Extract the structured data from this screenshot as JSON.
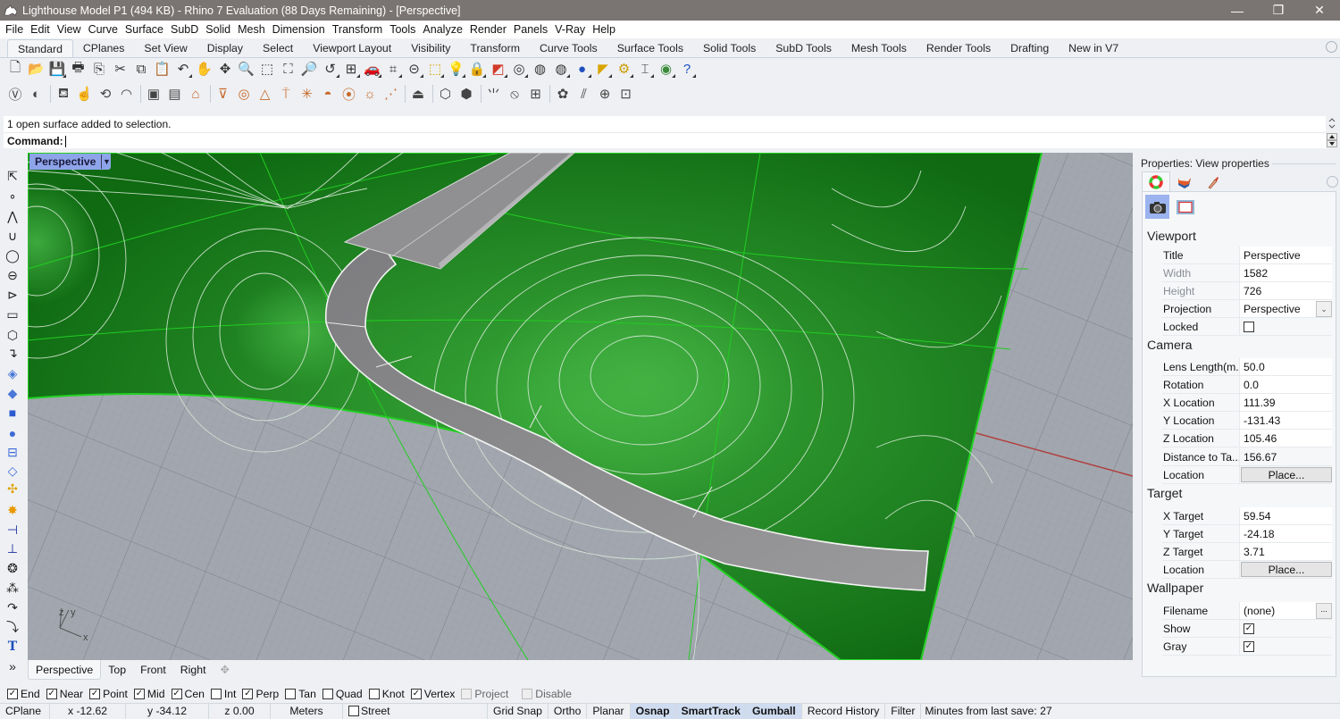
{
  "window": {
    "title": "Lighthouse Model P1 (494 KB) - Rhino 7 Evaluation (88 Days Remaining) - [Perspective]",
    "controls": {
      "minimize": "—",
      "restore": "❐",
      "close": "✕"
    }
  },
  "menu": [
    "File",
    "Edit",
    "View",
    "Curve",
    "Surface",
    "SubD",
    "Solid",
    "Mesh",
    "Dimension",
    "Transform",
    "Tools",
    "Analyze",
    "Render",
    "Panels",
    "V-Ray",
    "Help"
  ],
  "toolbar_tabs": {
    "active": "Standard",
    "items": [
      "Standard",
      "CPlanes",
      "Set View",
      "Display",
      "Select",
      "Viewport Layout",
      "Visibility",
      "Transform",
      "Curve Tools",
      "Surface Tools",
      "Solid Tools",
      "SubD Tools",
      "Mesh Tools",
      "Render Tools",
      "Drafting",
      "New in V7"
    ]
  },
  "standard_toolbar": [
    {
      "name": "new-file-icon",
      "glyph": "🗋"
    },
    {
      "name": "open-file-icon",
      "glyph": "📂"
    },
    {
      "name": "save-icon",
      "glyph": "💾",
      "sub": true
    },
    {
      "name": "print-icon",
      "glyph": "🖶"
    },
    {
      "name": "import-icon",
      "glyph": "⎘"
    },
    {
      "name": "cut-icon",
      "glyph": "✂"
    },
    {
      "name": "copy-icon",
      "glyph": "⧉"
    },
    {
      "name": "paste-icon",
      "glyph": "📋"
    },
    {
      "name": "undo-icon",
      "glyph": "↶",
      "sub": true
    },
    {
      "name": "pan-icon",
      "glyph": "✋"
    },
    {
      "name": "rotate-view-icon",
      "glyph": "✥"
    },
    {
      "name": "zoom-icon",
      "glyph": "🔍"
    },
    {
      "name": "zoom-window-icon",
      "glyph": "⬚"
    },
    {
      "name": "zoom-extents-icon",
      "glyph": "⛶"
    },
    {
      "name": "zoom-selected-icon",
      "glyph": "🔎"
    },
    {
      "name": "undo-view-icon",
      "glyph": "↺",
      "sub": true
    },
    {
      "name": "four-viewports-icon",
      "glyph": "⊞",
      "sub": true
    },
    {
      "name": "car-icon",
      "glyph": "🚗",
      "sub": true
    },
    {
      "name": "cplane-icon",
      "glyph": "⌗",
      "sub": true
    },
    {
      "name": "distance-icon",
      "glyph": "⊝",
      "sub": true
    },
    {
      "name": "grip-icon",
      "glyph": "⬚",
      "sub": true
    },
    {
      "name": "light-bulb-icon",
      "glyph": "💡",
      "sub": true
    },
    {
      "name": "lock-icon",
      "glyph": "🔒",
      "sub": true
    },
    {
      "name": "layers-icon",
      "glyph": "◩",
      "sub": true
    },
    {
      "name": "color-wheel-icon",
      "glyph": "◎",
      "sub": true
    },
    {
      "name": "wireframe-sphere-icon",
      "glyph": "◍"
    },
    {
      "name": "shaded-sphere-icon",
      "glyph": "◍",
      "sub": true
    },
    {
      "name": "render-sphere-icon",
      "glyph": "●",
      "sub": true
    },
    {
      "name": "sun-icon",
      "glyph": "◤",
      "sub": true
    },
    {
      "name": "options-icon",
      "glyph": "⚙",
      "sub": true
    },
    {
      "name": "dimension-icon",
      "glyph": "⌶",
      "sub": true
    },
    {
      "name": "grasshopper-icon",
      "glyph": "◉",
      "sub": true
    },
    {
      "name": "help-icon",
      "glyph": "?",
      "sub": true
    }
  ],
  "vray_toolbar": [
    {
      "name": "vray-logo-icon",
      "glyph": "Ⓥ"
    },
    {
      "name": "vray-asset-editor-icon",
      "glyph": "◐"
    },
    {
      "name": "sep"
    },
    {
      "name": "render-icon",
      "glyph": "⛾"
    },
    {
      "name": "interactive-render-icon",
      "glyph": "☝"
    },
    {
      "name": "render-cloud-icon",
      "glyph": "⟲"
    },
    {
      "name": "vision-icon",
      "glyph": "◠"
    },
    {
      "name": "sep"
    },
    {
      "name": "frame-buffer-icon",
      "glyph": "▣"
    },
    {
      "name": "frame-buffer-history-icon",
      "glyph": "▤"
    },
    {
      "name": "lightmix-icon",
      "glyph": "⌂"
    },
    {
      "name": "sep"
    },
    {
      "name": "rect-light-icon",
      "glyph": "⊽"
    },
    {
      "name": "sphere-light-icon",
      "glyph": "◎"
    },
    {
      "name": "spot-light-icon",
      "glyph": "△"
    },
    {
      "name": "ies-light-icon",
      "glyph": "⍑"
    },
    {
      "name": "omni-light-icon",
      "glyph": "✳"
    },
    {
      "name": "dome-light-icon",
      "glyph": "◓"
    },
    {
      "name": "mesh-light-icon",
      "glyph": "⦿"
    },
    {
      "name": "sun-light-icon",
      "glyph": "☼"
    },
    {
      "name": "direct-light-icon",
      "glyph": "⋰"
    },
    {
      "name": "sep"
    },
    {
      "name": "camera-icon",
      "glyph": "⏏"
    },
    {
      "name": "sep"
    },
    {
      "name": "proxy-export-icon",
      "glyph": "⬡"
    },
    {
      "name": "proxy-import-icon",
      "glyph": "⬢"
    },
    {
      "name": "sep"
    },
    {
      "name": "fur-icon",
      "glyph": "⺌"
    },
    {
      "name": "clipper-icon",
      "glyph": "⦸"
    },
    {
      "name": "mesh-clipper-icon",
      "glyph": "⊞"
    },
    {
      "name": "sep"
    },
    {
      "name": "material-pick-icon",
      "glyph": "✿"
    },
    {
      "name": "infinite-plane-icon",
      "glyph": "⫽"
    },
    {
      "name": "bake-icon",
      "glyph": "⊕"
    },
    {
      "name": "lock-camera-icon",
      "glyph": "⊡"
    }
  ],
  "command": {
    "history": "1 open surface added to selection.",
    "prompt_label": "Command:",
    "value": ""
  },
  "left_toolbar": [
    "select-icon",
    "point-icon",
    "polyline-icon",
    "curve-icon",
    "circle-icon",
    "ellipse-icon",
    "arc-icon",
    "rectangle-icon",
    "polygon-icon",
    "fillet-curve-icon",
    "surface-from-points-icon",
    "extrude-surface-icon",
    "box-icon",
    "sphere-boolean-icon",
    "cylinder-icon",
    "mesh-icon",
    "puzzle-icon",
    "explode-icon",
    "split-icon",
    "trim-icon",
    "group-icon",
    "points-on-icon",
    "curve-tools-icon",
    "fillet-edge-icon",
    "text-icon",
    "more-icon"
  ],
  "viewport": {
    "label": "Perspective",
    "axes": {
      "x": "x",
      "y": "y",
      "z": "z"
    },
    "colors": {
      "terrain": "#1d7e1d",
      "terrain_light": "#3aa93a",
      "road": "#8c8c8c",
      "grid": "#a2a7af",
      "x_axis": "#b0413e",
      "edge_highlight": "#22d022"
    }
  },
  "viewport_tabs": {
    "active": "Perspective",
    "items": [
      "Perspective",
      "Top",
      "Front",
      "Right"
    ],
    "add_icon": "✥"
  },
  "osnaps": [
    {
      "label": "End",
      "checked": true
    },
    {
      "label": "Near",
      "checked": true
    },
    {
      "label": "Point",
      "checked": true
    },
    {
      "label": "Mid",
      "checked": true
    },
    {
      "label": "Cen",
      "checked": true
    },
    {
      "label": "Int",
      "checked": false
    },
    {
      "label": "Perp",
      "checked": true
    },
    {
      "label": "Tan",
      "checked": false
    },
    {
      "label": "Quad",
      "checked": false
    },
    {
      "label": "Knot",
      "checked": false
    },
    {
      "label": "Vertex",
      "checked": true
    },
    {
      "label": "Project",
      "checked": false,
      "disabled": true
    },
    {
      "label": "Disable",
      "checked": false,
      "disabled": true
    }
  ],
  "status": {
    "cplane": "CPlane",
    "x": "x -12.62",
    "y": "y -34.12",
    "z": "z 0.00",
    "units": "Meters",
    "layer": "Street",
    "toggles": [
      {
        "label": "Grid Snap",
        "on": false
      },
      {
        "label": "Ortho",
        "on": false
      },
      {
        "label": "Planar",
        "on": false
      },
      {
        "label": "Osnap",
        "on": true
      },
      {
        "label": "SmartTrack",
        "on": true
      },
      {
        "label": "Gumball",
        "on": true
      },
      {
        "label": "Record History",
        "on": false
      },
      {
        "label": "Filter",
        "on": false
      }
    ],
    "save_info": "Minutes from last save: 27"
  },
  "properties": {
    "title": "Properties: View properties",
    "sections": {
      "viewport": {
        "heading": "Viewport",
        "title_label": "Title",
        "title_value": "Perspective",
        "width_label": "Width",
        "width_value": "1582",
        "height_label": "Height",
        "height_value": "726",
        "projection_label": "Projection",
        "projection_value": "Perspective",
        "locked_label": "Locked",
        "locked": false
      },
      "camera": {
        "heading": "Camera",
        "lens_label": "Lens Length(m...",
        "lens_value": "50.0",
        "rotation_label": "Rotation",
        "rotation_value": "0.0",
        "xloc_label": "X Location",
        "xloc_value": "111.39",
        "yloc_label": "Y Location",
        "yloc_value": "-131.43",
        "zloc_label": "Z Location",
        "zloc_value": "105.46",
        "dist_label": "Distance to Ta...",
        "dist_value": "156.67",
        "location_label": "Location",
        "place_button": "Place..."
      },
      "target": {
        "heading": "Target",
        "x_label": "X Target",
        "x_value": "59.54",
        "y_label": "Y Target",
        "y_value": "-24.18",
        "z_label": "Z Target",
        "z_value": "3.71",
        "location_label": "Location",
        "place_button": "Place..."
      },
      "wallpaper": {
        "heading": "Wallpaper",
        "filename_label": "Filename",
        "filename_value": "(none)",
        "browse_button": "...",
        "show_label": "Show",
        "show": true,
        "gray_label": "Gray",
        "gray": true
      }
    }
  }
}
